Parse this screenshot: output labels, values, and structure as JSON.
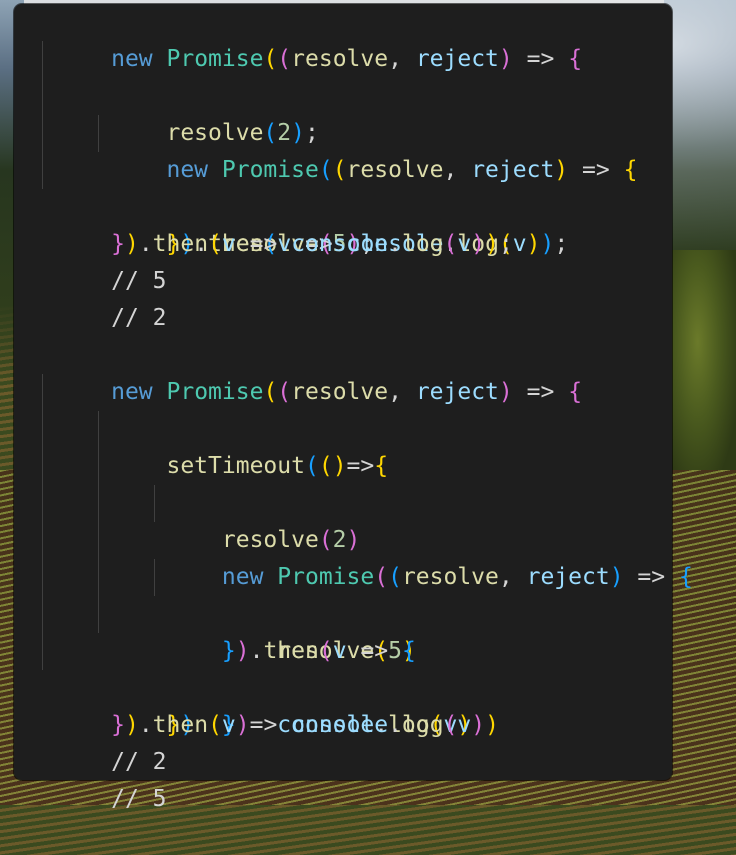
{
  "code_lines": [
    "new Promise((resolve, reject) => {",
    "    resolve(2);",
    "    new Promise((resolve, reject) => {",
    "        resolve(5);",
    "    }).then(v => console.log(v));",
    "}).then(v => console.log(v));",
    "// 5",
    "// 2",
    "",
    "new Promise((resolve, reject) => {",
    "    setTimeout(()=>{",
    "        resolve(2)",
    "        new Promise((resolve, reject) => {",
    "            resolve(5)",
    "        }).then(v => {",
    "            console.log(v)",
    "        })",
    "    })",
    "}).then(v => console.log(v))",
    "// 2",
    "// 5"
  ],
  "colors": {
    "editor_background": "#1e1e1e",
    "bracket_gold": "#ffd700",
    "bracket_purple": "#da70d6",
    "bracket_blue": "#179fff",
    "text": "#d4d4d4"
  }
}
